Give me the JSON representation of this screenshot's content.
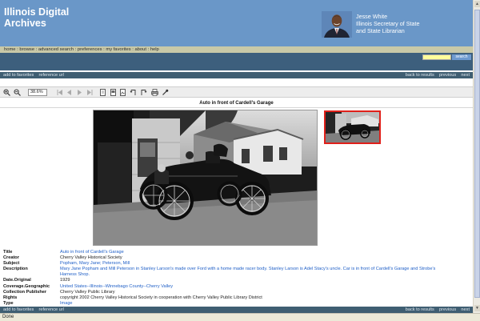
{
  "header": {
    "title": "Illinois Digital Archives",
    "official_name": "Jesse White",
    "official_title_1": "Illinois Secretary of State",
    "official_title_2": "and State Librarian"
  },
  "nav": {
    "items": [
      "home",
      "browse",
      "advanced search",
      "preferences",
      "my favorites",
      "about",
      "help"
    ],
    "separator": " : "
  },
  "search": {
    "placeholder": "",
    "button_label": "search"
  },
  "actions": {
    "add_favorites": "add to favorites",
    "reference_url": "reference url",
    "back_results": "back to results",
    "previous": "previous",
    "next": "next"
  },
  "toolbar": {
    "zoom_value": "38.6%"
  },
  "document": {
    "title": "Auto in front of Cardell's Garage"
  },
  "metadata": [
    {
      "label": "Title",
      "value": "Auto in front of Cardell's Garage"
    },
    {
      "label": "Creator",
      "value": "Cherry Valley Historical Society"
    },
    {
      "label": "Subject",
      "value": "Popham, Mary Jane; Peterson, Mill"
    },
    {
      "label": "Description",
      "value": "Mary Jane Popham and Mill Peterson in Stanley Larson's made over Ford with a home made racer body. Stanley Larson is Adel Stacy's uncle. Car is in front of Cardell's Garage and Strobe's"
    },
    {
      "label": "",
      "value": "Harness Shop."
    },
    {
      "label": "Date.Original",
      "value": "1929"
    },
    {
      "label": "Coverage.Geographic",
      "value": "United States--Illinois--Winnebago County--Cherry Valley"
    },
    {
      "label": "Collection Publisher",
      "value": "Cherry Valley Public Library"
    },
    {
      "label": "Rights",
      "value": "copyright 2002 Cherry Valley Historical Society in cooperation with Cherry Valley Public Library District"
    },
    {
      "label": "Type",
      "value": "Image"
    }
  ],
  "status": {
    "text": "Done"
  },
  "icons": {
    "zoom_in": "zoom-in-icon",
    "zoom_out": "zoom-out-icon",
    "first": "first-page-icon",
    "prev": "prev-page-icon",
    "next": "next-page-icon",
    "last": "last-page-icon",
    "fit_page": "fit-page-icon",
    "fit_width": "fit-width-icon",
    "fit_window": "fit-window-icon",
    "rotate_left": "rotate-left-icon",
    "rotate_right": "rotate-right-icon",
    "print": "print-icon",
    "tools": "tools-icon"
  },
  "colors": {
    "header": "#6a97c8",
    "nav": "#c9c9a8",
    "bar": "#3d5f7d",
    "link": "#1f5fc7",
    "thumb_border": "#e0201a"
  }
}
